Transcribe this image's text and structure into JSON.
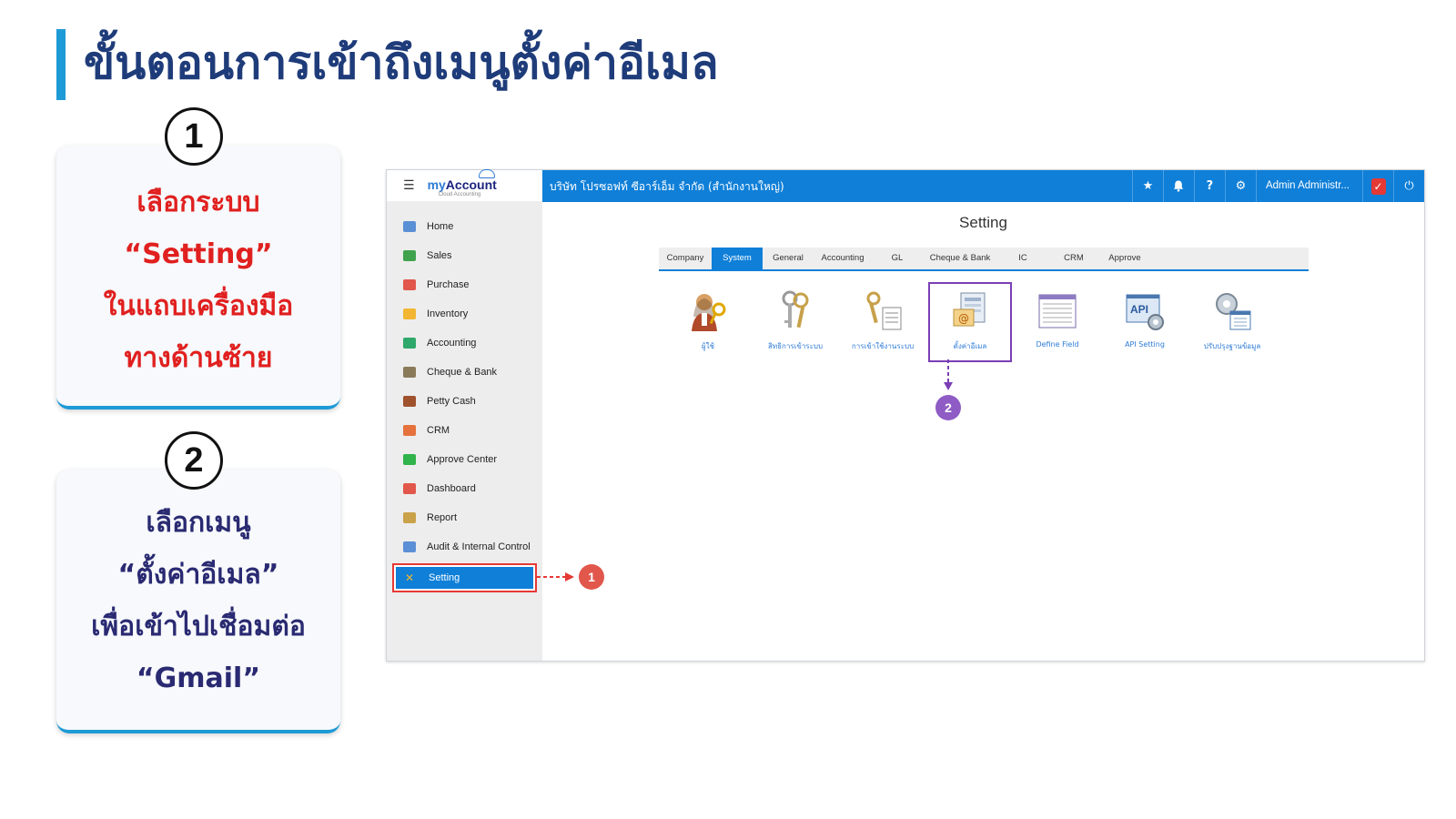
{
  "slide": {
    "title": "ขั้นตอนการเข้าถึงเมนูตั้งค่าอีเมล",
    "accent_color": "#1e9ad6"
  },
  "steps": [
    {
      "number": "1",
      "lines": [
        "เลือกระบบ",
        "“Setting”",
        "ในแถบเครื่องมือ",
        "ทางด้านซ้าย"
      ],
      "color": "#e0201f"
    },
    {
      "number": "2",
      "lines": [
        "เลือกเมนู",
        "“ตั้งค่าอีเมล”",
        "เพื่อเข้าไปเชื่อมต่อ",
        "“Gmail”"
      ],
      "color": "#2a2a72"
    }
  ],
  "app": {
    "logo": {
      "brand_prefix": "my",
      "brand_suffix": "Account",
      "tagline": "Cloud Accounting"
    },
    "company_name": "บริษัท โปรซอฟท์ ซีอาร์เอ็ม จำกัด (สำนักงานใหญ่)",
    "user_name": "Admin Administr...",
    "sidebar": [
      {
        "label": "Home",
        "icon": "home-icon",
        "color": "#5b8fd6"
      },
      {
        "label": "Sales",
        "icon": "money-icon",
        "color": "#3fa34d"
      },
      {
        "label": "Purchase",
        "icon": "cart-icon",
        "color": "#e2574c"
      },
      {
        "label": "Inventory",
        "icon": "box-icon",
        "color": "#f2b632"
      },
      {
        "label": "Accounting",
        "icon": "book-icon",
        "color": "#2fa86b"
      },
      {
        "label": "Cheque & Bank",
        "icon": "bank-icon",
        "color": "#8a7a5a"
      },
      {
        "label": "Petty Cash",
        "icon": "wallet-icon",
        "color": "#a0522d"
      },
      {
        "label": "CRM",
        "icon": "people-icon",
        "color": "#e5723c"
      },
      {
        "label": "Approve Center",
        "icon": "check-circle-icon",
        "color": "#2fb34a"
      },
      {
        "label": "Dashboard",
        "icon": "pie-chart-icon",
        "color": "#e2574c"
      },
      {
        "label": "Report",
        "icon": "report-icon",
        "color": "#caa24a"
      },
      {
        "label": "Audit & Internal Control",
        "icon": "magnifier-icon",
        "color": "#5b8fd6"
      },
      {
        "label": "Setting",
        "icon": "tools-icon",
        "color": "#f2b632",
        "active": true
      }
    ],
    "page_title": "Setting",
    "tabs": [
      {
        "label": "Company",
        "w": 58
      },
      {
        "label": "System",
        "w": 56,
        "active": true
      },
      {
        "label": "General",
        "w": 56
      },
      {
        "label": "Accounting",
        "w": 64
      },
      {
        "label": "GL",
        "w": 56
      },
      {
        "label": "Cheque & Bank",
        "w": 82
      },
      {
        "label": "IC",
        "w": 56
      },
      {
        "label": "CRM",
        "w": 56
      },
      {
        "label": "Approve",
        "w": 56
      }
    ],
    "system_items": [
      {
        "label": "ผู้ใช้",
        "icon": "user-key-icon"
      },
      {
        "label": "สิทธิการเข้าระบบ",
        "icon": "keys-icon"
      },
      {
        "label": "การเข้าใช้งานระบบ",
        "icon": "key-log-icon"
      },
      {
        "label": "ตั้งค่าอีเมล",
        "icon": "email-setting-icon",
        "selected": true
      },
      {
        "label": "Define Field",
        "icon": "define-field-icon"
      },
      {
        "label": "API Setting",
        "icon": "api-setting-icon"
      },
      {
        "label": "ปรับปรุงฐานข้อมูล",
        "icon": "database-update-icon"
      }
    ],
    "callouts": [
      {
        "number": "1",
        "color": "#e2574c"
      },
      {
        "number": "2",
        "color": "#8e5cc4"
      }
    ]
  }
}
